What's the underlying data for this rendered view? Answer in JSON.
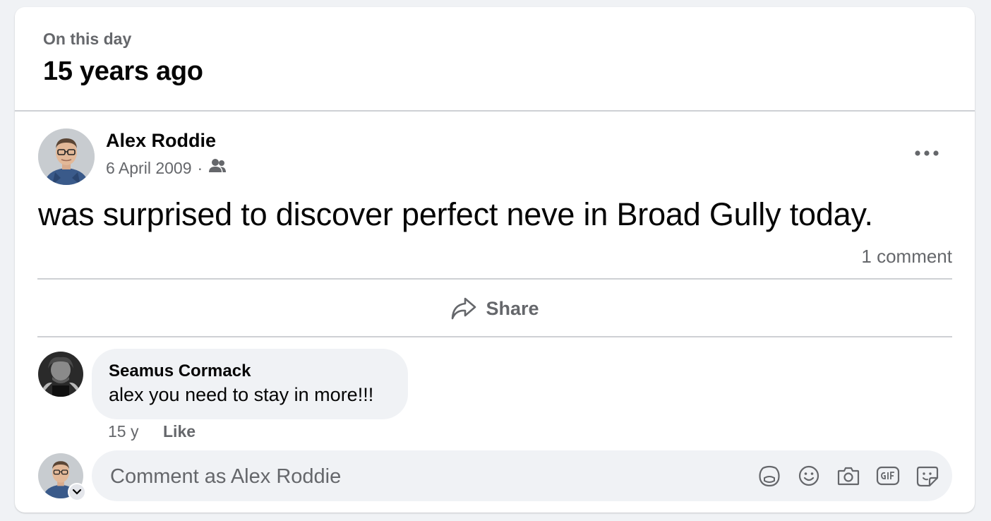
{
  "memory": {
    "kicker": "On this day",
    "title": "15 years ago"
  },
  "post": {
    "author": "Alex Roddie",
    "date": "6 April 2009",
    "separator": "·",
    "audience_icon": "friends-icon",
    "text": "was surprised to discover perfect neve in Broad Gully today.",
    "comment_count": "1 comment",
    "share_label": "Share"
  },
  "comment": {
    "author": "Seamus Cormack",
    "text": "alex you need to stay in more!!!",
    "age": "15 y",
    "like_label": "Like"
  },
  "composer": {
    "placeholder": "Comment as Alex Roddie",
    "icons": [
      "avatar-sticker-icon",
      "emoji-icon",
      "camera-icon",
      "gif-icon",
      "sticker-icon"
    ]
  },
  "colors": {
    "background": "#f0f2f5",
    "card": "#ffffff",
    "text_primary": "#050505",
    "text_secondary": "#65676b",
    "divider": "#ced0d4"
  }
}
